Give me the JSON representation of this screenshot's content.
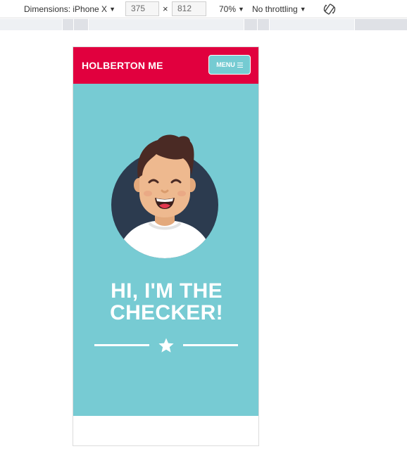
{
  "devtools": {
    "dimensions_label": "Dimensions: iPhone X",
    "width_value": "375",
    "times_sign": "×",
    "height_value": "812",
    "zoom_label": "70%",
    "throttling_label": "No throttling",
    "icons": {
      "caret": "caret-down-icon",
      "rotate": "rotate-icon"
    }
  },
  "site": {
    "brand": "HOLBERTON ME",
    "menu_label": "MENU",
    "hero_title_line1": "HI, I'M THE",
    "hero_title_line2": "CHECKER!",
    "colors": {
      "header": "#e1003e",
      "hero": "#77cbd3",
      "menu_button": "#75cbd2",
      "avatar_bg": "#2c3b4f"
    }
  }
}
